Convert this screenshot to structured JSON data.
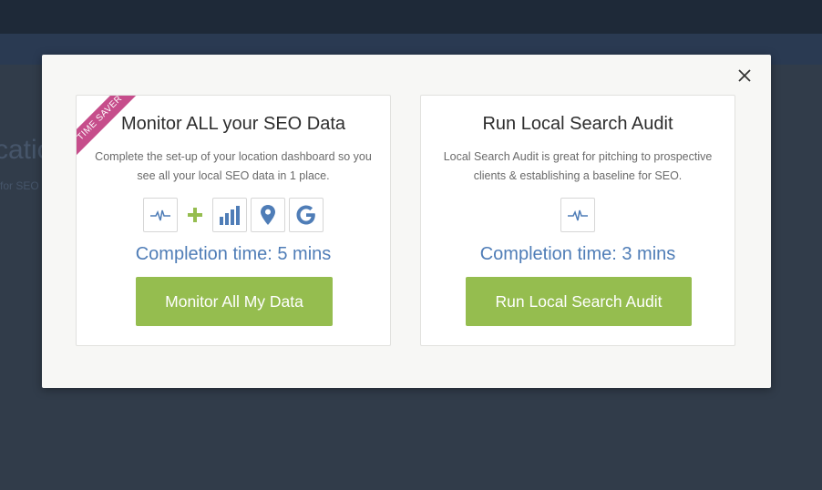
{
  "background": {
    "partial_title": "catio",
    "partial_subtitle": "for SEO"
  },
  "modal": {
    "close_icon": "close-icon",
    "cards": [
      {
        "ribbon": "TIME SAVER",
        "title": "Monitor ALL your SEO Data",
        "description": "Complete the set-up of your location dashboard so you see all your local SEO data in 1 place.",
        "icons": [
          "pulse-icon",
          "plus-icon",
          "bar-chart-icon",
          "map-pin-icon",
          "google-icon"
        ],
        "completion": "Completion time: 5 mins",
        "button_label": "Monitor All My Data"
      },
      {
        "title": "Run Local Search Audit",
        "description": "Local Search Audit is great for pitching to prospective clients & establishing a baseline for SEO.",
        "icons": [
          "pulse-icon"
        ],
        "completion": "Completion time: 3 mins",
        "button_label": "Run Local Search Audit"
      }
    ]
  },
  "colors": {
    "accent_green": "#95bd4f",
    "accent_blue": "#4f7db7",
    "ribbon_pink": "#c64d8b"
  }
}
